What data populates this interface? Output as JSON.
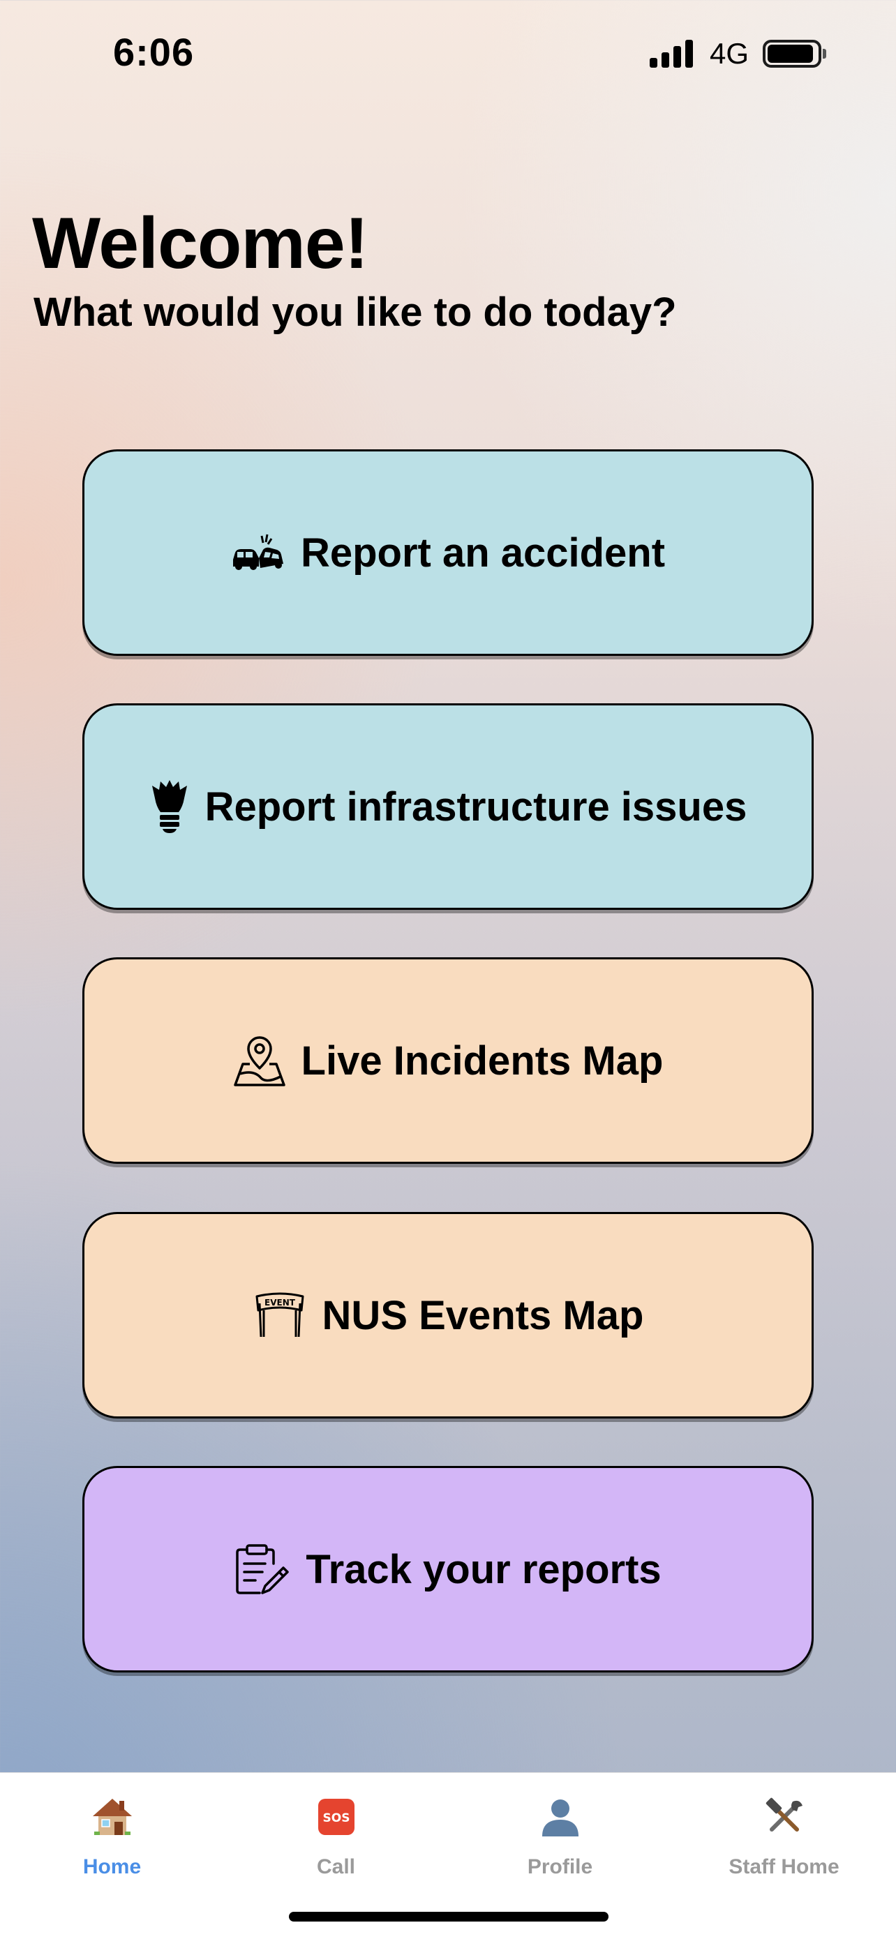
{
  "status_bar": {
    "time": "6:06",
    "network": "4G"
  },
  "header": {
    "title": "Welcome!",
    "subtitle": "What would you like to do today?"
  },
  "actions": [
    {
      "label": "Report an accident",
      "icon": "car-crash-icon",
      "color": "#bbe0e6"
    },
    {
      "label": "Report infrastructure issues",
      "icon": "lightbulb-icon",
      "color": "#bbe0e6"
    },
    {
      "label": "Live Incidents Map",
      "icon": "map-pin-icon",
      "color": "#f9dcbf"
    },
    {
      "label": "NUS Events Map",
      "icon": "event-banner-icon",
      "color": "#f9dcbf"
    },
    {
      "label": "Track your reports",
      "icon": "clipboard-edit-icon",
      "color": "#d3b6f7"
    }
  ],
  "event_icon_text": "EVENT",
  "tabs": [
    {
      "label": "Home",
      "icon": "house-icon",
      "active": true
    },
    {
      "label": "Call",
      "icon": "sos-icon",
      "icon_text": "SOS",
      "active": false
    },
    {
      "label": "Profile",
      "icon": "person-silhouette-icon",
      "active": false
    },
    {
      "label": "Staff Home",
      "icon": "hammer-wrench-icon",
      "active": false
    }
  ],
  "colors": {
    "active_tab": "#4a8ee6",
    "inactive_tab": "#9a9a9a"
  }
}
